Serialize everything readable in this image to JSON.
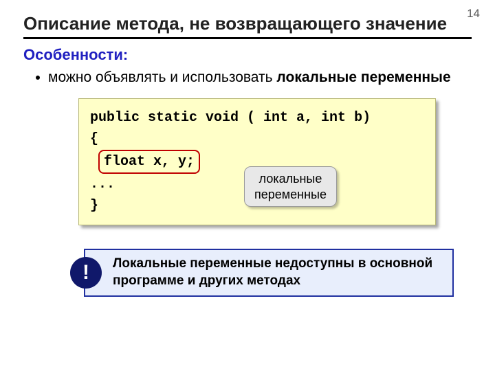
{
  "page_number": "14",
  "title": "Описание метода, не возвращающего значение",
  "subtitle": "Особенности:",
  "bullet": {
    "prefix": "можно объявлять и использовать ",
    "bold": "локальные переменные"
  },
  "code": {
    "line1": "public static void ( int a, int b)",
    "line2": "{",
    "var_decl": "float x, y;",
    "line4": "...",
    "line5": "}"
  },
  "callout": "локальные\nпеременные",
  "note": {
    "badge": "!",
    "text": "Локальные переменные недоступны в основной программе и других методах"
  }
}
